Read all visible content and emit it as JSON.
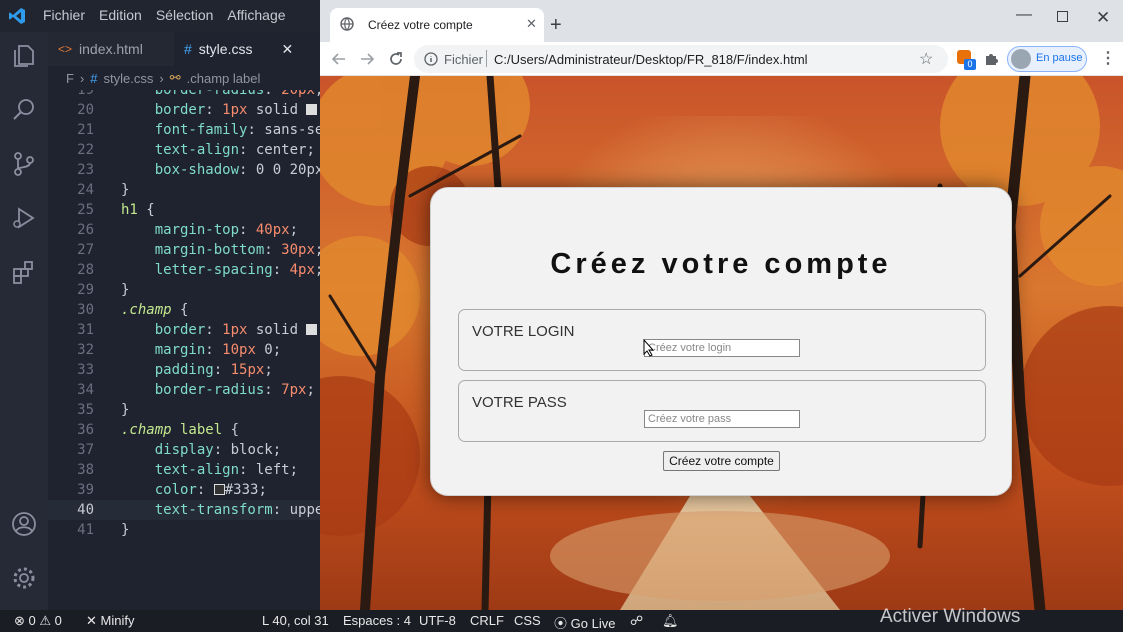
{
  "vscode": {
    "menu": [
      "Fichier",
      "Edition",
      "Sélection",
      "Affichage"
    ],
    "tabs": [
      {
        "label": "index.html",
        "icon": "<>"
      },
      {
        "label": "style.css",
        "icon": "#"
      }
    ],
    "breadcrumb": {
      "folder": "F",
      "file": "style.css",
      "symbol": ".champ label"
    },
    "lines": [
      {
        "n": "19",
        "segs": [
          [
            "    ",
            "p"
          ],
          [
            "border-radius",
            "prop"
          ],
          [
            ": ",
            "p"
          ],
          [
            "20px",
            "num"
          ],
          [
            ";",
            "p"
          ]
        ]
      },
      {
        "n": "20",
        "segs": [
          [
            "    ",
            "p"
          ],
          [
            "border",
            "prop"
          ],
          [
            ": ",
            "p"
          ],
          [
            "1px",
            "num"
          ],
          [
            " solid ",
            "txt"
          ]
        ],
        "swatch": "#dddddd"
      },
      {
        "n": "21",
        "segs": [
          [
            "    ",
            "p"
          ],
          [
            "font-family",
            "prop"
          ],
          [
            ": ",
            "p"
          ],
          [
            "sans-serif",
            "txt"
          ],
          [
            ";",
            "p"
          ]
        ]
      },
      {
        "n": "22",
        "segs": [
          [
            "    ",
            "p"
          ],
          [
            "text-align",
            "prop"
          ],
          [
            ": ",
            "p"
          ],
          [
            "center",
            "txt"
          ],
          [
            ";",
            "p"
          ]
        ]
      },
      {
        "n": "23",
        "segs": [
          [
            "    ",
            "p"
          ],
          [
            "box-shadow",
            "prop"
          ],
          [
            ": ",
            "p"
          ],
          [
            "0 0 20px",
            "txt"
          ]
        ]
      },
      {
        "n": "24",
        "segs": [
          [
            "}",
            "p"
          ]
        ]
      },
      {
        "n": "25",
        "segs": [
          [
            "h1",
            "sel"
          ],
          [
            " {",
            "p"
          ]
        ]
      },
      {
        "n": "26",
        "segs": [
          [
            "    ",
            "p"
          ],
          [
            "margin-top",
            "prop"
          ],
          [
            ": ",
            "p"
          ],
          [
            "40px",
            "num"
          ],
          [
            ";",
            "p"
          ]
        ]
      },
      {
        "n": "27",
        "segs": [
          [
            "    ",
            "p"
          ],
          [
            "margin-bottom",
            "prop"
          ],
          [
            ": ",
            "p"
          ],
          [
            "30px",
            "num"
          ],
          [
            ";",
            "p"
          ]
        ]
      },
      {
        "n": "28",
        "segs": [
          [
            "    ",
            "p"
          ],
          [
            "letter-spacing",
            "prop"
          ],
          [
            ": ",
            "p"
          ],
          [
            "4px",
            "num"
          ],
          [
            ";",
            "p"
          ]
        ]
      },
      {
        "n": "29",
        "segs": [
          [
            "}",
            "p"
          ]
        ]
      },
      {
        "n": "30",
        "segs": [
          [
            ".champ",
            "kw"
          ],
          [
            " {",
            "p"
          ]
        ]
      },
      {
        "n": "31",
        "segs": [
          [
            "    ",
            "p"
          ],
          [
            "border",
            "prop"
          ],
          [
            ": ",
            "p"
          ],
          [
            "1px",
            "num"
          ],
          [
            " solid ",
            "txt"
          ]
        ],
        "swatch": "#dddddd"
      },
      {
        "n": "32",
        "segs": [
          [
            "    ",
            "p"
          ],
          [
            "margin",
            "prop"
          ],
          [
            ": ",
            "p"
          ],
          [
            "10px",
            "num"
          ],
          [
            " 0",
            "txt"
          ],
          [
            ";",
            "p"
          ]
        ]
      },
      {
        "n": "33",
        "segs": [
          [
            "    ",
            "p"
          ],
          [
            "padding",
            "prop"
          ],
          [
            ": ",
            "p"
          ],
          [
            "15px",
            "num"
          ],
          [
            ";",
            "p"
          ]
        ]
      },
      {
        "n": "34",
        "segs": [
          [
            "    ",
            "p"
          ],
          [
            "border-radius",
            "prop"
          ],
          [
            ": ",
            "p"
          ],
          [
            "7px",
            "num"
          ],
          [
            ";",
            "p"
          ]
        ]
      },
      {
        "n": "35",
        "segs": [
          [
            "}",
            "p"
          ]
        ]
      },
      {
        "n": "36",
        "segs": [
          [
            ".champ",
            "kw"
          ],
          [
            " label",
            "sel"
          ],
          [
            " {",
            "p"
          ]
        ]
      },
      {
        "n": "37",
        "segs": [
          [
            "    ",
            "p"
          ],
          [
            "display",
            "prop"
          ],
          [
            ": ",
            "p"
          ],
          [
            "block",
            "txt"
          ],
          [
            ";",
            "p"
          ]
        ]
      },
      {
        "n": "38",
        "segs": [
          [
            "    ",
            "p"
          ],
          [
            "text-align",
            "prop"
          ],
          [
            ": ",
            "p"
          ],
          [
            "left",
            "txt"
          ],
          [
            ";",
            "p"
          ]
        ]
      },
      {
        "n": "39",
        "segs": [
          [
            "    ",
            "p"
          ],
          [
            "color",
            "prop"
          ],
          [
            ": ",
            "p"
          ],
          [
            "#333",
            "txt"
          ],
          [
            ";",
            "p"
          ]
        ],
        "swatch_before": "#333333",
        "swatch_index": 3
      },
      {
        "n": "40",
        "segs": [
          [
            "    ",
            "p"
          ],
          [
            "text-transform",
            "prop"
          ],
          [
            ": ",
            "p"
          ],
          [
            "uppercase",
            "txt"
          ],
          [
            ";",
            "p"
          ]
        ],
        "current": true
      },
      {
        "n": "41",
        "segs": [
          [
            "}",
            "p"
          ]
        ]
      }
    ],
    "status": {
      "errors": "0",
      "warnings": "0",
      "minify": "Minify",
      "position": "L 40, col 31",
      "spaces": "Espaces : 4",
      "encoding": "UTF-8",
      "eol": "CRLF",
      "language": "CSS",
      "golive": "Go Live"
    }
  },
  "chrome": {
    "tab_title": "Créez votre compte",
    "url_label": "Fichier",
    "url": "C:/Users/Administrateur/Desktop/FR_818/F/index.html",
    "profile_label": "En pause",
    "extension_badge": "0"
  },
  "page": {
    "title": "Créez votre compte",
    "login_label": "Votre login",
    "login_placeholder": "Créez votre login",
    "pass_label": "Votre pass",
    "pass_placeholder": "Créez votre pass",
    "submit": "Créez votre compte"
  },
  "watermark": "Activer Windows",
  "colors": {
    "vscode_bg": "#1f2330",
    "accent_blue": "#1a73e8",
    "statusbar": "#1b1d24"
  }
}
